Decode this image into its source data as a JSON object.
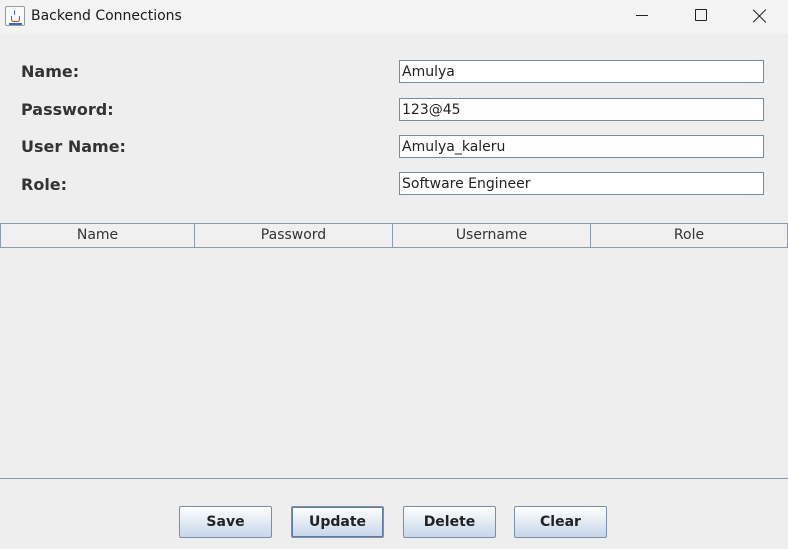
{
  "window": {
    "title": "Backend Connections"
  },
  "form": {
    "name_label": "Name:",
    "name_value": "Amulya",
    "password_label": "Password:",
    "password_value": "123@45",
    "username_label": "User Name:",
    "username_value": "Amulya_kaleru",
    "role_label": "Role:",
    "role_value": "Software Engineer"
  },
  "table": {
    "columns": [
      "Name",
      "Password",
      "Username",
      "Role"
    ],
    "rows": []
  },
  "buttons": {
    "save": "Save",
    "update": "Update",
    "delete": "Delete",
    "clear": "Clear"
  }
}
